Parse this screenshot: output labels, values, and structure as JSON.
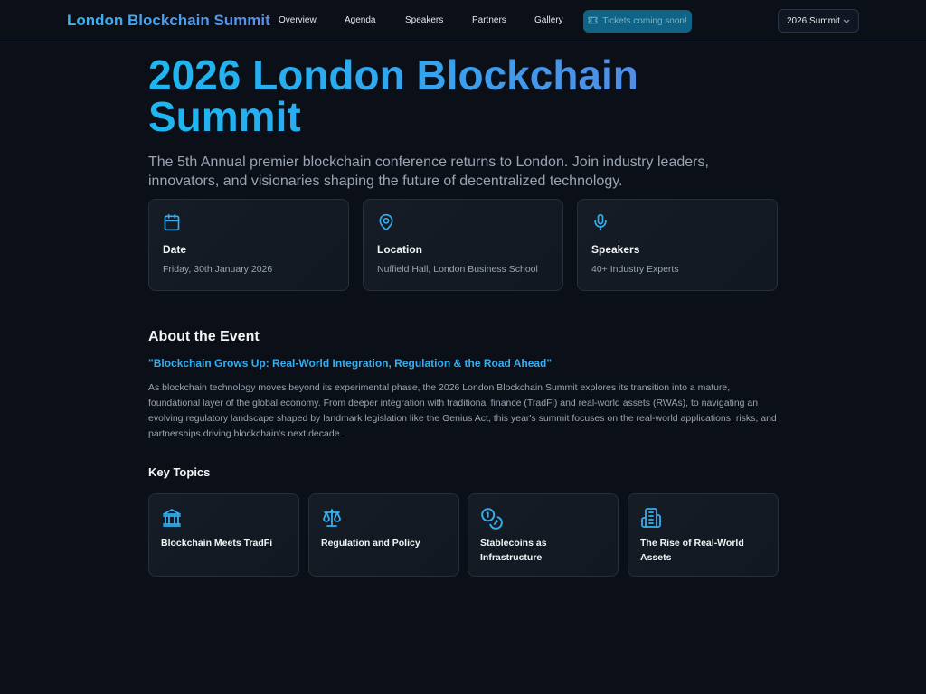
{
  "nav": {
    "brand": "London Blockchain Summit",
    "links": [
      "Overview",
      "Agenda",
      "Speakers",
      "Partners",
      "Gallery"
    ],
    "tickets_label": "Tickets coming soon!",
    "summit_select": "2026 Summit"
  },
  "hero": {
    "title": "2026 London Blockchain Summit",
    "subtitle": "The 5th Annual premier blockchain conference returns to London. Join industry leaders, innovators, and visionaries shaping the future of decentralized technology."
  },
  "info_cards": [
    {
      "icon": "calendar-icon",
      "label": "Date",
      "value": "Friday, 30th January 2026"
    },
    {
      "icon": "location-pin-icon",
      "label": "Location",
      "value": "Nuffield Hall, London Business School"
    },
    {
      "icon": "microphone-icon",
      "label": "Speakers",
      "value": "40+ Industry Experts"
    }
  ],
  "about": {
    "title": "About the Event",
    "tagline": "\"Blockchain Grows Up: Real-World Integration, Regulation & the Road Ahead\"",
    "body": "As blockchain technology moves beyond its experimental phase, the 2026 London Blockchain Summit explores its transition into a mature, foundational layer of the global economy. From deeper integration with traditional finance (TradFi) and real-world assets (RWAs), to navigating an evolving regulatory landscape shaped by landmark legislation like the Genius Act, this year's summit focuses on the real-world applications, risks, and partnerships driving blockchain's next decade."
  },
  "topics": {
    "title": "Key Topics",
    "items": [
      {
        "icon": "bank-icon",
        "name": "Blockchain Meets TradFi"
      },
      {
        "icon": "scales-icon",
        "name": "Regulation and Policy"
      },
      {
        "icon": "coins-icon",
        "name": "Stablecoins as Infrastructure"
      },
      {
        "icon": "document-icon",
        "name": "The Rise of Real-World Assets"
      }
    ]
  },
  "colors": {
    "accent": "#35aef0",
    "background": "#0b0f17",
    "card": "#151b25",
    "button": "#0e6386"
  }
}
